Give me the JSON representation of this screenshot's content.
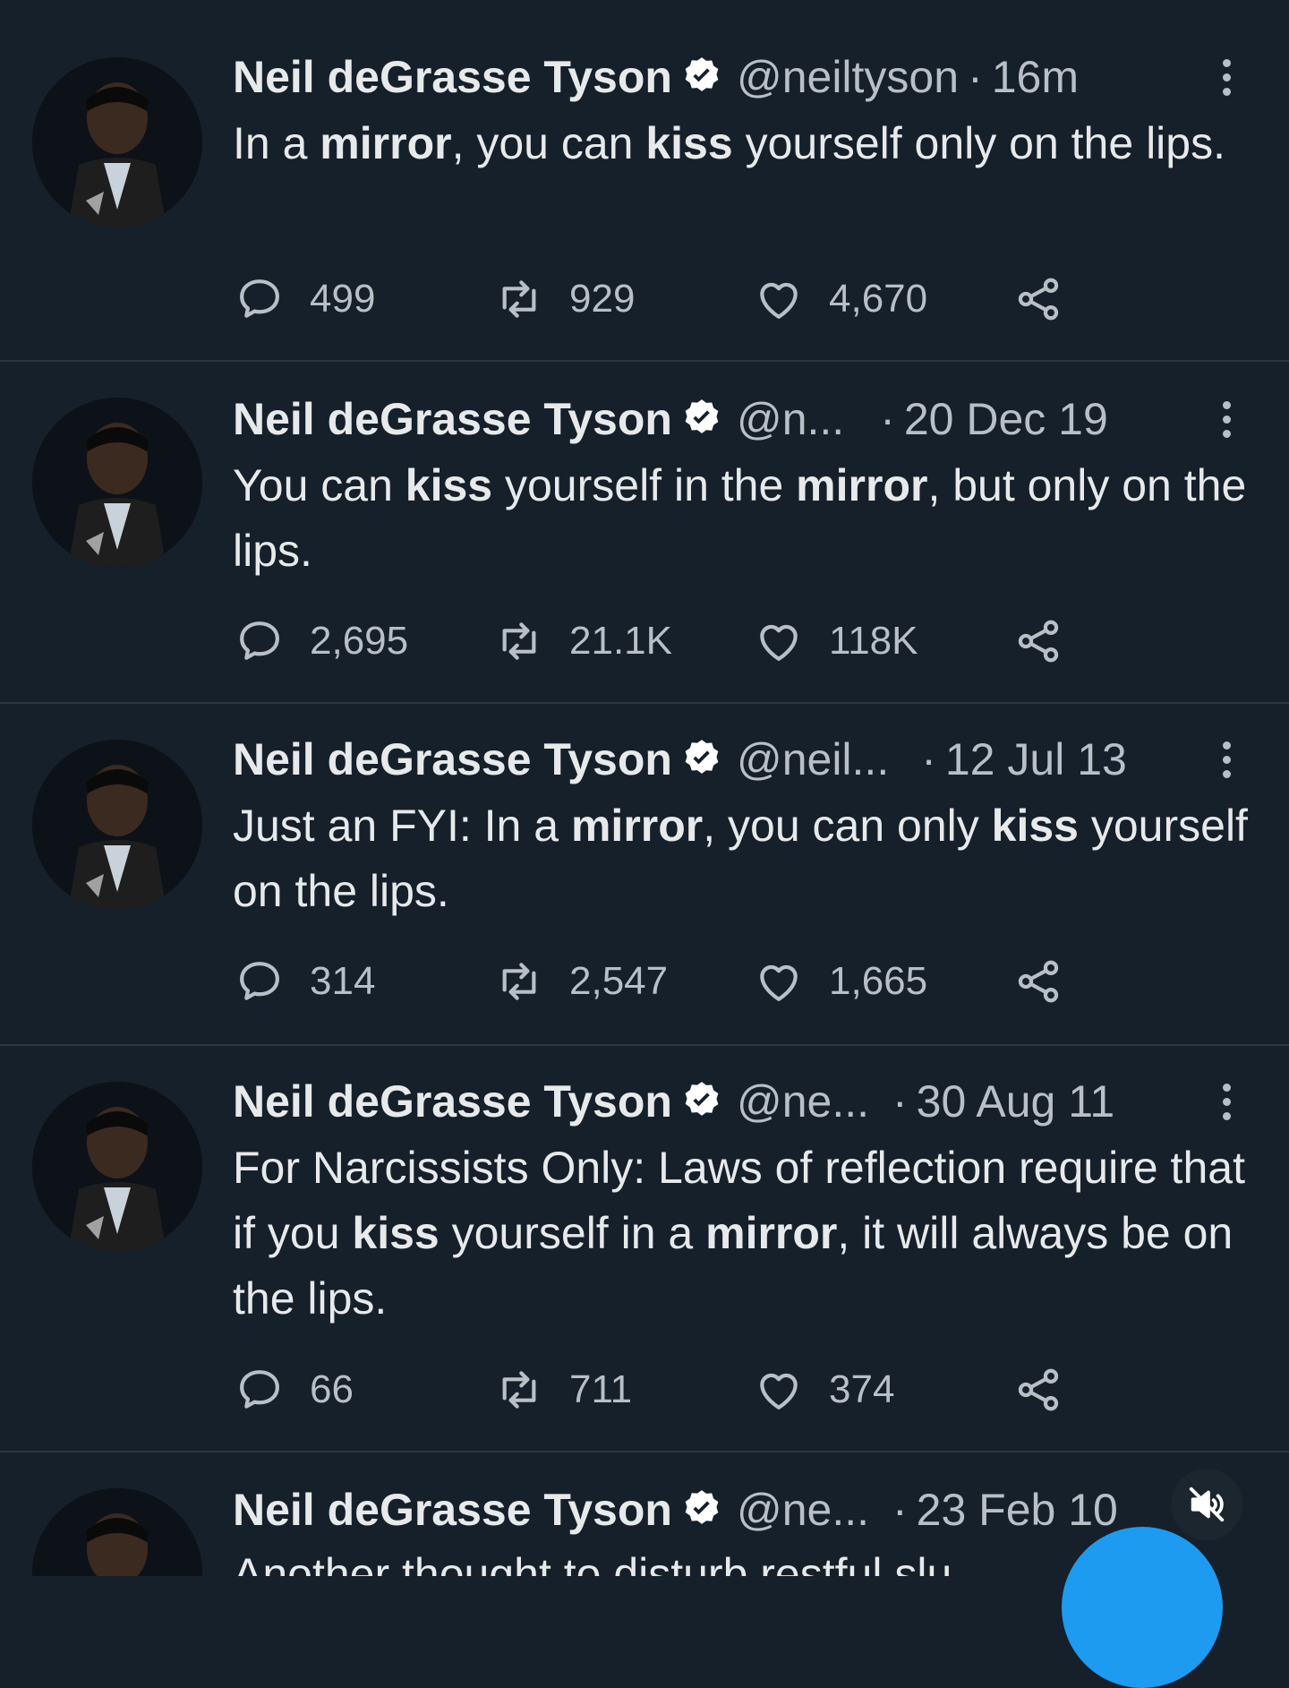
{
  "tweets": [
    {
      "name": "Neil deGrasse Tyson",
      "handle": "@neiltyson",
      "time": "16m",
      "text_parts": [
        {
          "t": "In a ",
          "b": false
        },
        {
          "t": "mirror",
          "b": true
        },
        {
          "t": ", you can ",
          "b": false
        },
        {
          "t": "kiss",
          "b": true
        },
        {
          "t": " yourself only on the lips.",
          "b": false
        }
      ],
      "replies": "499",
      "retweets": "929",
      "likes": "4,670"
    },
    {
      "name": "Neil deGrasse Tyson",
      "handle": "@n...",
      "time": "20 Dec 19",
      "text_parts": [
        {
          "t": "You can ",
          "b": false
        },
        {
          "t": "kiss",
          "b": true
        },
        {
          "t": " yourself in the ",
          "b": false
        },
        {
          "t": "mirror",
          "b": true
        },
        {
          "t": ", but only on the lips.",
          "b": false
        }
      ],
      "replies": "2,695",
      "retweets": "21.1K",
      "likes": "118K"
    },
    {
      "name": "Neil deGrasse Tyson",
      "handle": "@neil...",
      "time": "12 Jul 13",
      "text_parts": [
        {
          "t": "Just an FYI:  In a ",
          "b": false
        },
        {
          "t": "mirror",
          "b": true
        },
        {
          "t": ", you can only ",
          "b": false
        },
        {
          "t": "kiss",
          "b": true
        },
        {
          "t": " yourself on the lips.",
          "b": false
        }
      ],
      "replies": "314",
      "retweets": "2,547",
      "likes": "1,665"
    },
    {
      "name": "Neil deGrasse Tyson",
      "handle": "@ne...",
      "time": "30 Aug 11",
      "text_parts": [
        {
          "t": "For Narcissists Only: Laws of reflection require that if you ",
          "b": false
        },
        {
          "t": "kiss",
          "b": true
        },
        {
          "t": " yourself in a ",
          "b": false
        },
        {
          "t": "mirror",
          "b": true
        },
        {
          "t": ", it will always be on the lips.",
          "b": false
        }
      ],
      "replies": "66",
      "retweets": "711",
      "likes": "374"
    },
    {
      "name": "Neil deGrasse Tyson",
      "handle": "@ne...",
      "time": "23 Feb 10",
      "text_parts": [
        {
          "t": "Another thought to disturb restful slu",
          "b": false
        }
      ]
    }
  ],
  "colors": {
    "background": "#15202b",
    "text": "#e7e9ea",
    "muted": "#b8bfc6",
    "divider": "#2b3640",
    "verified": "#ffffff",
    "fab": "#1d9bf0"
  },
  "icons": {
    "reply": "speech-bubble-icon",
    "retweet": "retweet-arrows-icon",
    "like": "heart-icon",
    "share": "share-nodes-icon",
    "more": "vertical-dots-icon",
    "verified": "verified-badge-icon",
    "mute": "muted-speaker-icon"
  }
}
